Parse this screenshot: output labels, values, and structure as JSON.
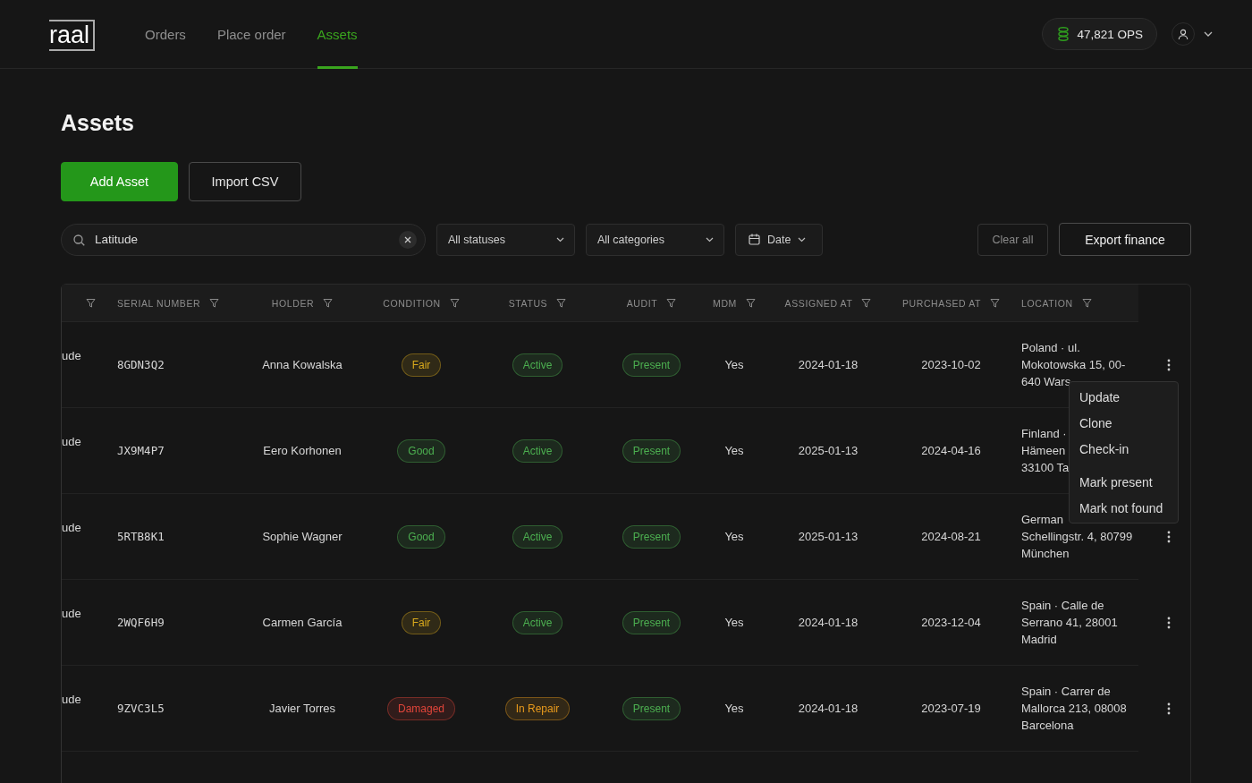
{
  "brand": {
    "logo": "raal"
  },
  "nav": [
    {
      "label": "Orders",
      "selected": false
    },
    {
      "label": "Place order",
      "selected": false
    },
    {
      "label": "Assets",
      "selected": true
    }
  ],
  "balance": {
    "text": "47,821 OPS"
  },
  "page": {
    "title": "Assets"
  },
  "actions": [
    {
      "label": "Add Asset",
      "kind": "primary"
    },
    {
      "label": "Import CSV",
      "kind": "secondary"
    }
  ],
  "search": {
    "value": "Latitude"
  },
  "filters": [
    {
      "label": "All statuses",
      "kind": "select"
    },
    {
      "label": "All categories",
      "kind": "select"
    },
    {
      "label": "Date",
      "kind": "date"
    }
  ],
  "toolbar_buttons": [
    {
      "label": "Clear all",
      "kind": "muted"
    },
    {
      "label": "Export finance",
      "kind": "outline"
    }
  ],
  "table": {
    "columns": [
      {},
      {
        "label": "SERIAL NUMBER"
      },
      {
        "label": "HOLDER"
      },
      {
        "label": "CONDITION"
      },
      {
        "label": "STATUS"
      },
      {
        "label": "AUDIT"
      },
      {
        "label": "MDM"
      },
      {
        "label": "ASSIGNED AT"
      },
      {
        "label": "PURCHASED AT"
      },
      {
        "label": "LOCATION"
      }
    ],
    "rows": [
      {
        "column_1": "ude",
        "serial": "8GDN3Q2",
        "holder": "Anna Kowalska",
        "condition": {
          "text": "Fair",
          "color": "#d9a91c"
        },
        "status": {
          "text": "Active",
          "color": "#4caf50"
        },
        "audit": {
          "text": "Present",
          "color": "#4caf50"
        },
        "mdm": "Yes",
        "assigned_at": "2024-01-18",
        "purchased_at": "2023-10-02",
        "location": [
          "Poland · ul.",
          "Mokotowska 15, 00-",
          "640 Wars"
        ],
        "row_menu": true
      },
      {
        "column_1": "ude",
        "serial": "JX9M4P7",
        "holder": "Eero Korhonen",
        "condition": {
          "text": "Good",
          "color": "#4caf50"
        },
        "status": {
          "text": "Active",
          "color": "#4caf50"
        },
        "audit": {
          "text": "Present",
          "color": "#4caf50"
        },
        "mdm": "Yes",
        "assigned_at": "2025-01-13",
        "purchased_at": "2024-04-16",
        "location": [
          "Finland ·",
          "Hämeen",
          "33100 Ta"
        ]
      },
      {
        "column_1": "ude",
        "serial": "5RTB8K1",
        "holder": "Sophie Wagner",
        "condition": {
          "text": "Good",
          "color": "#4caf50"
        },
        "status": {
          "text": "Active",
          "color": "#4caf50"
        },
        "audit": {
          "text": "Present",
          "color": "#4caf50"
        },
        "mdm": "Yes",
        "assigned_at": "2025-01-13",
        "purchased_at": "2024-08-21",
        "location": [
          "German",
          "Schellingstr. 4, 80799",
          "München"
        ],
        "row_menu": true
      },
      {
        "column_1": "ude",
        "serial": "2WQF6H9",
        "holder": "Carmen García",
        "condition": {
          "text": "Fair",
          "color": "#d9a91c"
        },
        "status": {
          "text": "Active",
          "color": "#4caf50"
        },
        "audit": {
          "text": "Present",
          "color": "#4caf50"
        },
        "mdm": "Yes",
        "assigned_at": "2024-01-18",
        "purchased_at": "2023-12-04",
        "location": [
          "Spain · Calle de",
          "Serrano 41, 28001",
          "Madrid"
        ],
        "row_menu": true
      },
      {
        "column_1": "ude",
        "serial": "9ZVC3L5",
        "holder": "Javier Torres",
        "condition": {
          "text": "Damaged",
          "color": "#e0453a"
        },
        "status": {
          "text": "In Repair",
          "color": "#e89a1c"
        },
        "audit": {
          "text": "Present",
          "color": "#4caf50"
        },
        "mdm": "Yes",
        "assigned_at": "2024-01-18",
        "purchased_at": "2023-07-19",
        "location": [
          "Spain · Carrer de",
          "Mallorca 213, 08008",
          "Barcelona"
        ],
        "row_menu": true
      }
    ]
  },
  "context_menu": {
    "groups": [
      [
        {
          "label": "Update"
        },
        {
          "label": "Clone"
        },
        {
          "label": "Check-in"
        }
      ],
      [
        {
          "label": "Mark present"
        },
        {
          "label": "Mark not found"
        }
      ]
    ]
  }
}
